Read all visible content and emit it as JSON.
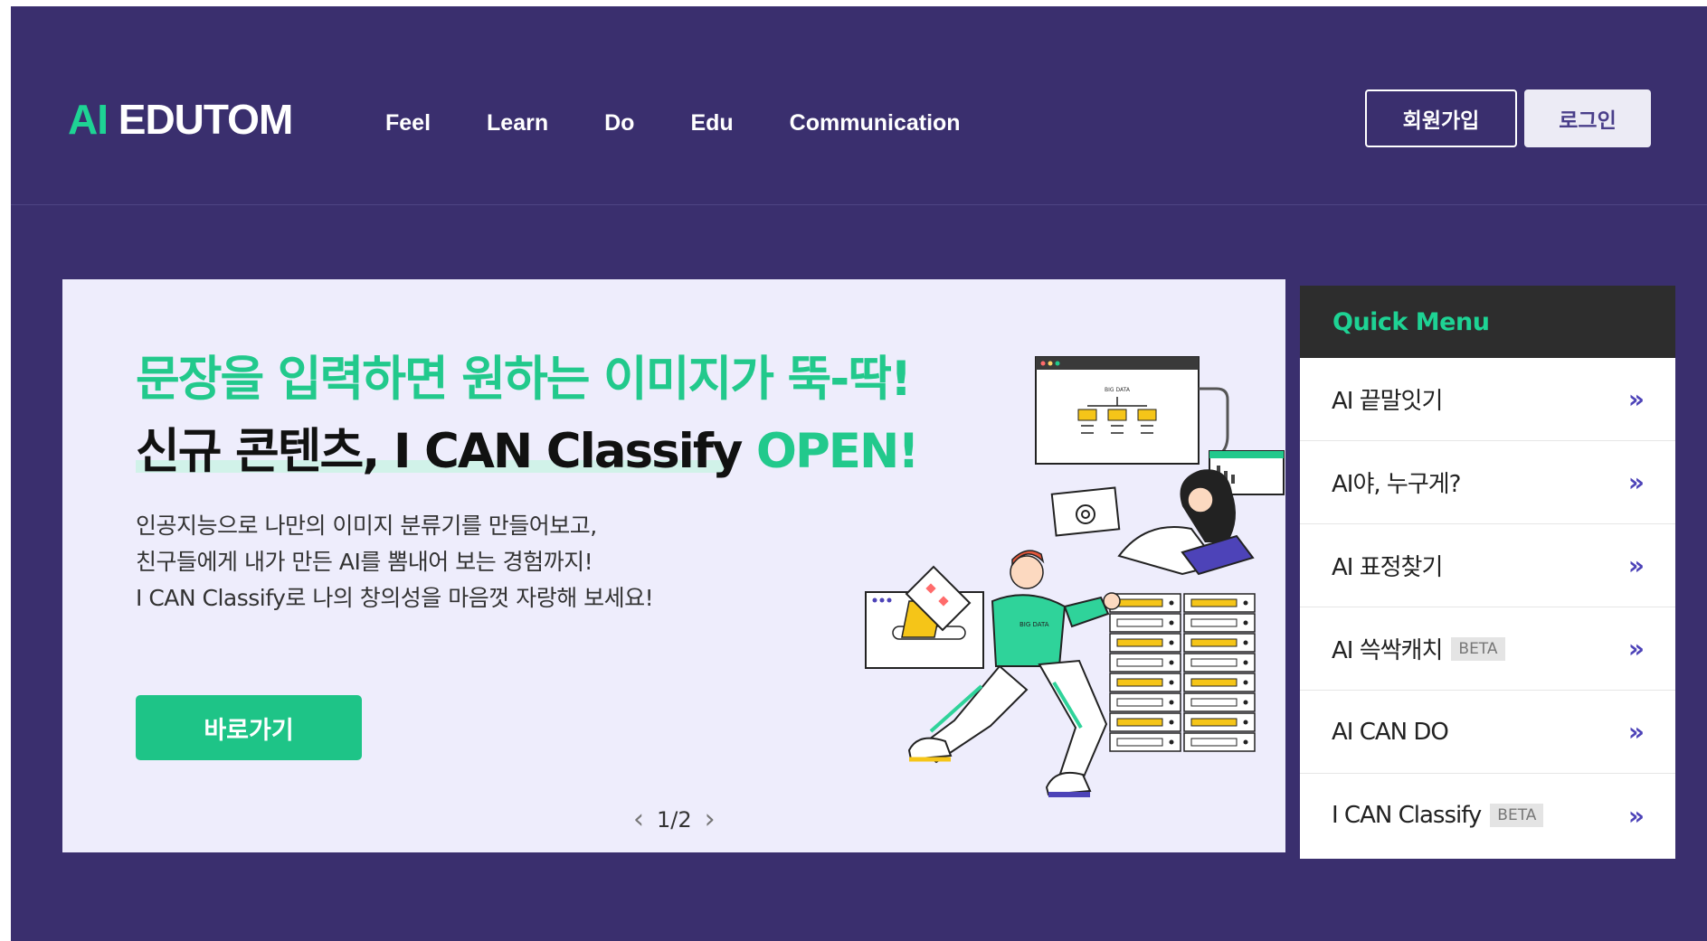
{
  "header": {
    "logo_ai": "AI",
    "logo_rest": " EDUTOM",
    "nav": [
      "Feel",
      "Learn",
      "Do",
      "Edu",
      "Communication"
    ],
    "signup_label": "회원가입",
    "login_label": "로그인"
  },
  "banner": {
    "headline_line1": "문장을 입력하면 원하는 이미지가 뚝-딱!",
    "headline_line2_black": "신규 콘텐츠, I CAN Classify ",
    "headline_line2_green": "OPEN!",
    "description": [
      "인공지능으로 나만의 이미지 분류기를 만들어보고,",
      "친구들에게 내가 만든 AI를 뽐내어 보는 경험까지!",
      "I CAN Classify로 나의 창의성을 마음껏 자랑해 보세요!"
    ],
    "go_button": "바로가기",
    "pager": "1/2",
    "illustration_text_big_data": "BIG DATA",
    "illustration_text_shirt": "BIG DATA"
  },
  "quick_menu": {
    "title": "Quick Menu",
    "items": [
      {
        "label": "AI 끝말잇기",
        "badge": ""
      },
      {
        "label": "AI야, 누구게?",
        "badge": ""
      },
      {
        "label": "AI 표정찾기",
        "badge": ""
      },
      {
        "label": "AI 쓱싹캐치",
        "badge": "BETA"
      },
      {
        "label": "AI CAN DO",
        "badge": ""
      },
      {
        "label": "I CAN Classify",
        "badge": "BETA"
      }
    ],
    "arrow": "»"
  },
  "colors": {
    "background": "#3a2f6e",
    "accent_green": "#1ed394",
    "banner_bg": "#eeedfc",
    "quick_menu_head": "#2d2d2d",
    "arrow_color": "#4d43b8"
  }
}
